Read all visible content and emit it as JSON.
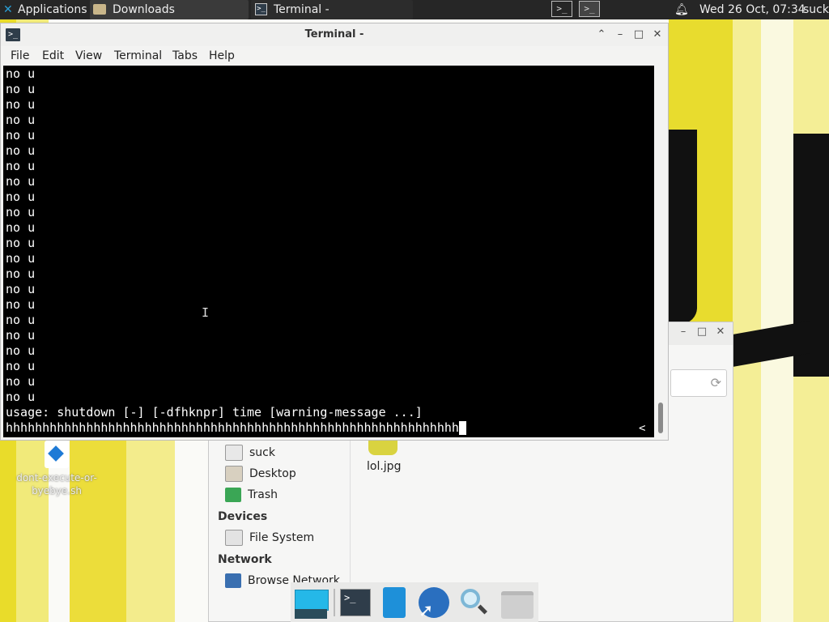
{
  "top_panel": {
    "applications_label": "Applications",
    "tasks": [
      {
        "label": "Downloads",
        "icon": "folder-icon"
      },
      {
        "label": "Terminal -",
        "icon": "terminal-icon"
      }
    ],
    "workspace_1": ">_",
    "workspace_2": ">_",
    "clock": "Wed 26 Oct, 07:34",
    "user": "suck"
  },
  "terminal": {
    "title": "Terminal -",
    "menu": [
      "File",
      "Edit",
      "View",
      "Terminal",
      "Tabs",
      "Help"
    ],
    "output_lines": [
      "no u",
      "no u",
      "no u",
      "no u",
      "no u",
      "no u",
      "no u",
      "no u",
      "no u",
      "no u",
      "no u",
      "no u",
      "no u",
      "no u",
      "no u",
      "no u",
      "no u",
      "no u",
      "no u",
      "no u",
      "no u",
      "no u",
      "usage: shutdown [-] [-dfhknpr] time [warning-message ...]"
    ],
    "input_line": "hhhhhhhhhhhhhhhhhhhhhhhhhhhhhhhhhhhhhhhhhhhhhhhhhhhhhhhhhhhhhh",
    "overflow_marker": "<",
    "colors": {
      "background": "#000000",
      "foreground": "#ffffff"
    }
  },
  "file_manager": {
    "places": [
      "suck",
      "Desktop",
      "Trash"
    ],
    "devices_heading": "Devices",
    "devices": [
      "File System"
    ],
    "network_heading": "Network",
    "network": [
      "Browse Network"
    ],
    "files": [
      {
        "name": "lol.jpg"
      }
    ]
  },
  "desktop": {
    "icons": [
      {
        "label": "dont-execute-or-byebye.sh"
      }
    ]
  },
  "dock": {
    "items": [
      "desktop-icon",
      "terminal-icon",
      "mail-icon",
      "web-browser-icon",
      "search-icon",
      "file-manager-icon"
    ]
  }
}
